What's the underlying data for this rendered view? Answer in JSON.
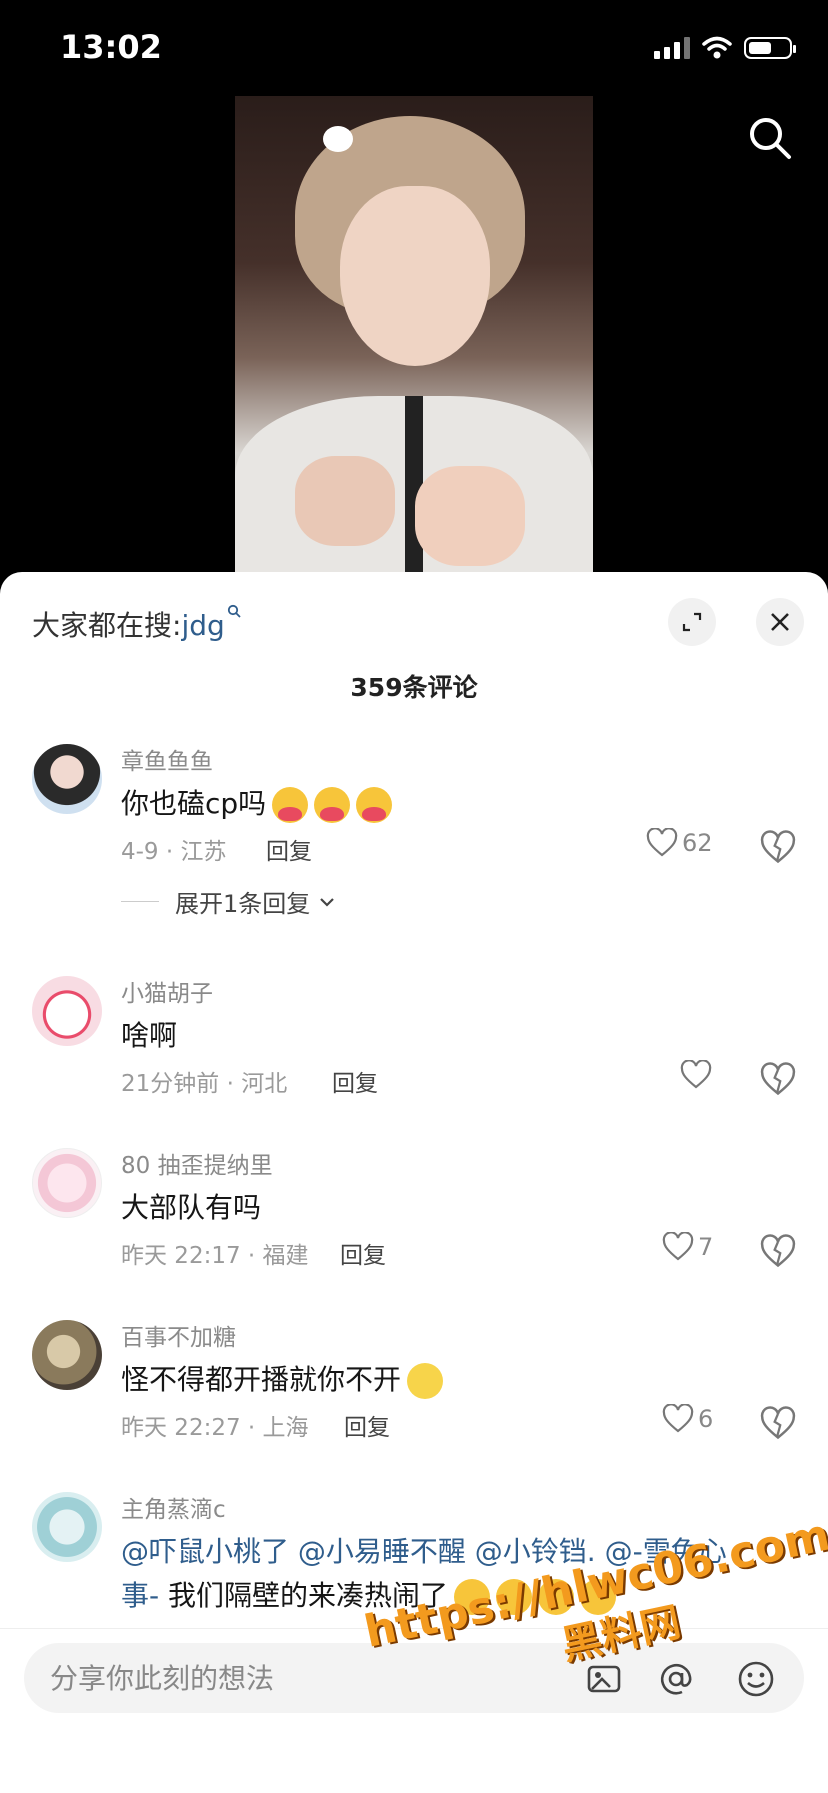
{
  "status": {
    "time": "13:02"
  },
  "hot_search": {
    "prefix": "大家都在搜:",
    "keyword": "jdg"
  },
  "comments_header": {
    "count_label": "359条评论"
  },
  "comments": [
    {
      "user": "章鱼鱼鱼",
      "text": "你也磕cp吗",
      "emoji_count": 3,
      "meta": "4-9 · 江苏",
      "reply": "回复",
      "likes": "62",
      "expand": "展开1条回复"
    },
    {
      "user": "小猫胡子",
      "text": "啥啊",
      "meta": "21分钟前 · 河北",
      "reply": "回复",
      "likes": ""
    },
    {
      "user": "80 抽歪提纳里",
      "text": "大部队有吗",
      "meta": "昨天 22:17 · 福建",
      "reply": "回复",
      "likes": "7"
    },
    {
      "user": "百事不加糖",
      "text": "怪不得都开播就你不开",
      "meta": "昨天 22:27 · 上海",
      "reply": "回复",
      "likes": "6"
    },
    {
      "user": "主角蒸滴c",
      "mentions_line1": "@吓鼠小桃了 @小易睡不醒 @小铃铛. @-雪兔心",
      "mention_line2": "事-",
      "text_line2": " 我们隔壁的来凑热闹了"
    }
  ],
  "input": {
    "placeholder": "分享你此刻的想法"
  },
  "watermark": {
    "url": "https://hlwc06.com",
    "name": "黑料网"
  },
  "colors": {
    "link": "#2f5d8c",
    "watermark": "#f39a1e"
  }
}
